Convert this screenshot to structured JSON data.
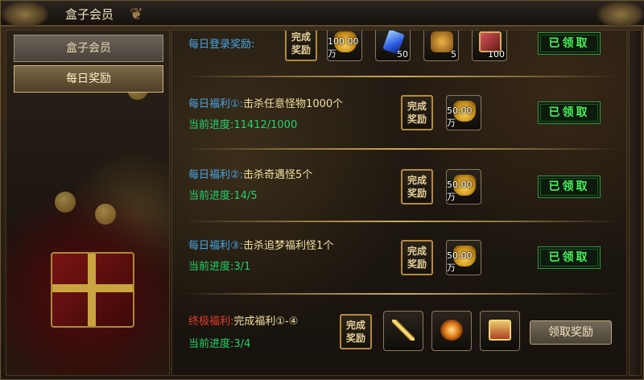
{
  "window": {
    "title": "盒子会员"
  },
  "sidebar": {
    "items": [
      {
        "label": "盒子会员",
        "active": false
      },
      {
        "label": "每日奖励",
        "active": true
      }
    ]
  },
  "stamp_text": {
    "line1": "完成",
    "line2": "奖励"
  },
  "claimed_text": "已领取",
  "login_reward": {
    "title": "每日登录奖励:",
    "rewards": [
      {
        "icon": "gold-ingot-icon",
        "count": "100.00万"
      },
      {
        "icon": "blue-crystal-icon",
        "count": "50"
      },
      {
        "icon": "gold-treasure-icon",
        "count": "5"
      },
      {
        "icon": "red-giftbox-icon",
        "count": "100"
      }
    ]
  },
  "quests": [
    {
      "label": "每日福利①:",
      "task": "击杀任意怪物1000个",
      "progress_label": "当前进度:",
      "progress": "11412/1000",
      "reward": {
        "icon": "gold-ingot-icon",
        "count": "50.00万"
      }
    },
    {
      "label": "每日福利②:",
      "task": "击杀奇遇怪5个",
      "progress_label": "当前进度:",
      "progress": "14/5",
      "reward": {
        "icon": "gold-ingot-icon",
        "count": "50.00万"
      }
    },
    {
      "label": "每日福利③:",
      "task": "击杀追梦福利怪1个",
      "progress_label": "当前进度:",
      "progress": "3/1",
      "reward": {
        "icon": "gold-ingot-icon",
        "count": "50.00万"
      }
    }
  ],
  "ultimate": {
    "label": "终极福利:",
    "task": "完成福利①-④",
    "progress_label": "当前进度:",
    "progress": "3/4",
    "rewards": [
      {
        "icon": "golden-sword-icon"
      },
      {
        "icon": "fire-orb-icon"
      },
      {
        "icon": "treasure-chest-icon"
      }
    ],
    "button_label": "领取奖励"
  },
  "colors": {
    "quest_label": "#46a6e6",
    "progress": "#22d36a",
    "ultimate_label": "#e83a2a",
    "claimed": "#48f05a"
  }
}
